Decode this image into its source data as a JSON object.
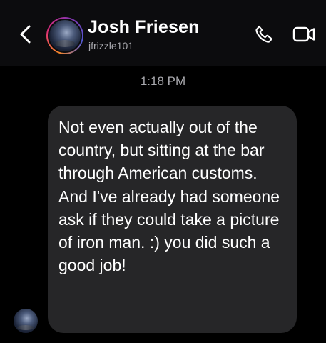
{
  "header": {
    "contact_name": "Josh Friesen",
    "username": "jfrizzle101",
    "icons": {
      "back": "chevron-left-icon",
      "call": "phone-icon",
      "video": "video-camera-icon"
    }
  },
  "thread": {
    "timestamp": "1:18 PM",
    "messages": [
      {
        "sender": "Josh Friesen",
        "text": "Not even actually out of the country, but sitting at the bar through American customs. And I've already had someone ask if they could take a picture of iron man. :) you did such a good job!"
      }
    ]
  },
  "colors": {
    "background": "#000000",
    "header_background": "#0c0c0e",
    "bubble_background": "#262628",
    "primary_text": "#ffffff",
    "secondary_text": "#a8a8ad"
  }
}
